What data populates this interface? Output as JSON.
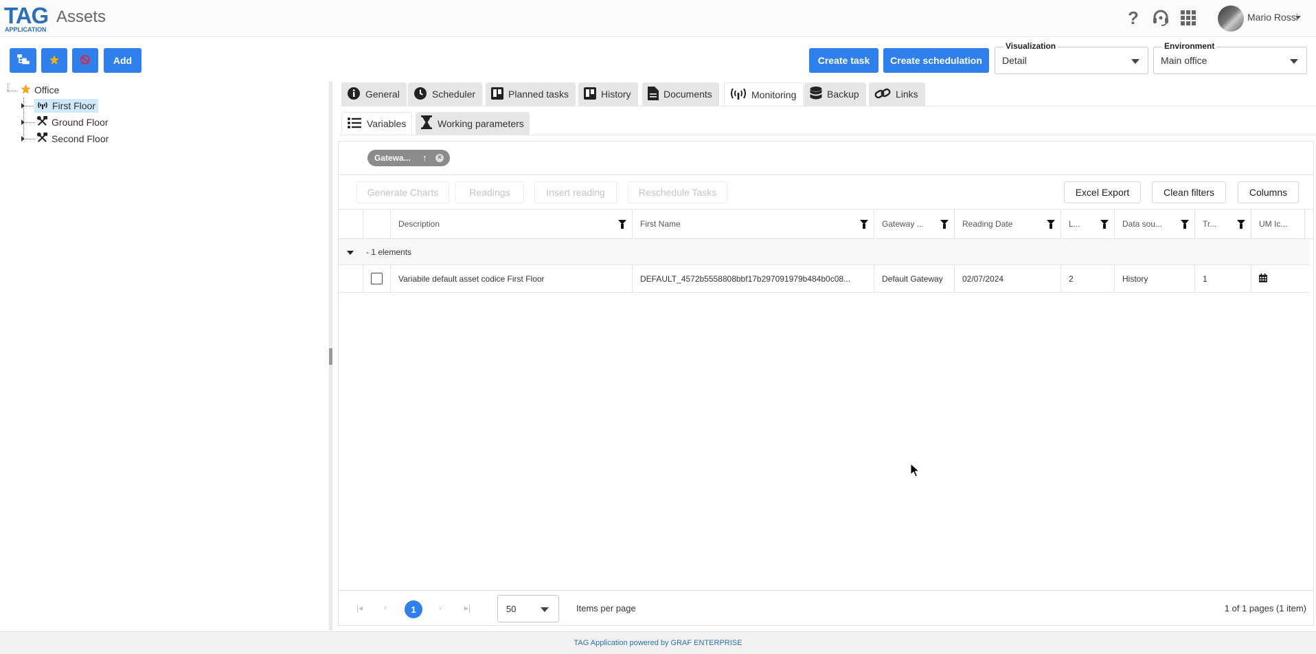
{
  "app": {
    "logo_main": "TAG",
    "logo_sub": "APPLICATION",
    "page_title": "Assets",
    "user_name": "Mario Rossi",
    "accent_color": "#2f80ed"
  },
  "header_icons": [
    "help-icon",
    "headset-icon",
    "apps-grid-icon"
  ],
  "toolbar": {
    "icon_buttons": [
      "tree-structure-icon",
      "star-icon",
      "block-icon"
    ],
    "add_label": "Add",
    "create_task_label": "Create task",
    "create_schedulation_label": "Create schedulation",
    "visualization": {
      "label": "Visualization",
      "value": "Detail"
    },
    "environment": {
      "label": "Environment",
      "value": "Main office"
    }
  },
  "tree": {
    "root": {
      "label": "Office",
      "icon": "star-icon"
    },
    "children": [
      {
        "label": "First Floor",
        "icon": "antenna-icon",
        "selected": true
      },
      {
        "label": "Ground Floor",
        "icon": "tools-icon",
        "selected": false
      },
      {
        "label": "Second Floor",
        "icon": "tools-icon",
        "selected": false
      }
    ]
  },
  "tabs": [
    {
      "label": "General",
      "icon": "info-icon"
    },
    {
      "label": "Scheduler",
      "icon": "clock-icon"
    },
    {
      "label": "Planned tasks",
      "icon": "board-icon"
    },
    {
      "label": "History",
      "icon": "board-icon"
    },
    {
      "label": "Documents",
      "icon": "document-icon"
    },
    {
      "label": "Monitoring",
      "icon": "antenna-icon",
      "active": true
    },
    {
      "label": "Backup",
      "icon": "database-icon"
    },
    {
      "label": "Links",
      "icon": "link-icon"
    }
  ],
  "subtabs": [
    {
      "label": "Variables",
      "icon": "list-icon",
      "active": true
    },
    {
      "label": "Working parameters",
      "icon": "hourglass-icon"
    }
  ],
  "grid": {
    "group_chip": "Gatewa...",
    "action_buttons": [
      "Generate Charts",
      "Readings",
      "Insert reading",
      "Reschedule Tasks"
    ],
    "right_buttons": [
      "Excel Export",
      "Clean filters",
      "Columns"
    ],
    "columns": [
      "Description",
      "First Name",
      "Gateway ...",
      "Reading Date",
      "L...",
      "Data sou...",
      "Tr...",
      "UM Ic..."
    ],
    "group_label": "- 1 elements",
    "rows": [
      {
        "description": "Variabile default asset codice First Floor",
        "first_name": "DEFAULT_4572b5558808bbf17b297091979b484b0c08...",
        "gateway": "Default Gateway",
        "reading_date": "02/07/2024",
        "l": "2",
        "data_source": "History",
        "tr": "1",
        "um_icon": "calendar-icon"
      }
    ]
  },
  "pager": {
    "current_page": "1",
    "page_size": "50",
    "items_per_page_label": "Items per page",
    "info": "1 of 1 pages (1 item)"
  },
  "footer": {
    "text": "TAG Application powered by GRAF ENTERPRISE"
  }
}
